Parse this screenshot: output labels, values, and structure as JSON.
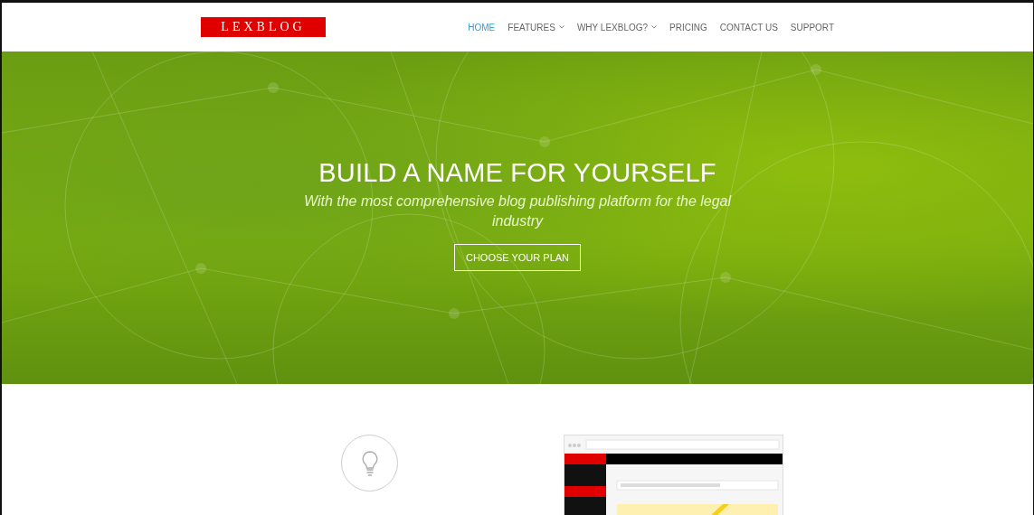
{
  "header": {
    "logo": "LEXBLOG",
    "nav": [
      {
        "label": "HOME",
        "selected": true,
        "dropdown": false
      },
      {
        "label": "FEATURES",
        "selected": false,
        "dropdown": true
      },
      {
        "label": "WHY LEXBLOG?",
        "selected": false,
        "dropdown": true
      },
      {
        "label": "PRICING",
        "selected": false,
        "dropdown": false
      },
      {
        "label": "CONTACT US",
        "selected": false,
        "dropdown": false
      },
      {
        "label": "SUPPORT",
        "selected": false,
        "dropdown": false
      }
    ]
  },
  "hero": {
    "title": "BUILD A NAME FOR YOURSELF",
    "subtitle": "With the most comprehensive blog publishing platform for the legal industry",
    "button": "CHOOSE YOUR PLAN"
  }
}
